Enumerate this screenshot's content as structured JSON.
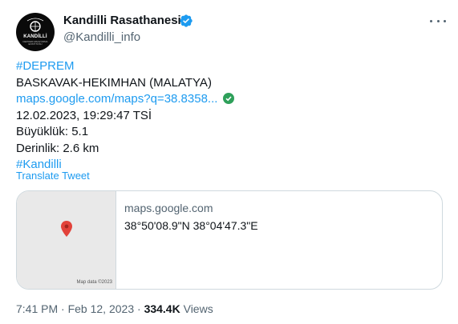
{
  "author": {
    "display_name": "Kandilli Rasathanesi",
    "handle": "@Kandilli_info",
    "avatar_text": "KANDİLLİ",
    "avatar_subtext": "DEPREM ARAŞTIRMA ENSTİTÜSÜ"
  },
  "tweet": {
    "hashtag_1": "#DEPREM",
    "location": "BASKAVAK-HEKIMHAN (MALATYA)",
    "map_link": "maps.google.com/maps?q=38.8358...",
    "datetime": "12.02.2023, 19:29:47 TSİ",
    "magnitude": "Büyüklük: 5.1",
    "depth": "Derinlik: 2.6 km",
    "hashtag_2": "#Kandilli",
    "translate_label": "Translate Tweet"
  },
  "card": {
    "domain": "maps.google.com",
    "title": "38°50'08.9\"N 38°04'47.3\"E",
    "map_credit": "Map data ©2023"
  },
  "meta": {
    "time": "7:41 PM",
    "separator": "·",
    "date": "Feb 12, 2023",
    "views_count": "334.4K",
    "views_label": "Views"
  },
  "colors": {
    "link": "#1d9bf0",
    "verified": "#1d9bf0",
    "secondary_text": "#536471",
    "map_pin": "#e2423a",
    "link_badge": "#2ea05a"
  }
}
